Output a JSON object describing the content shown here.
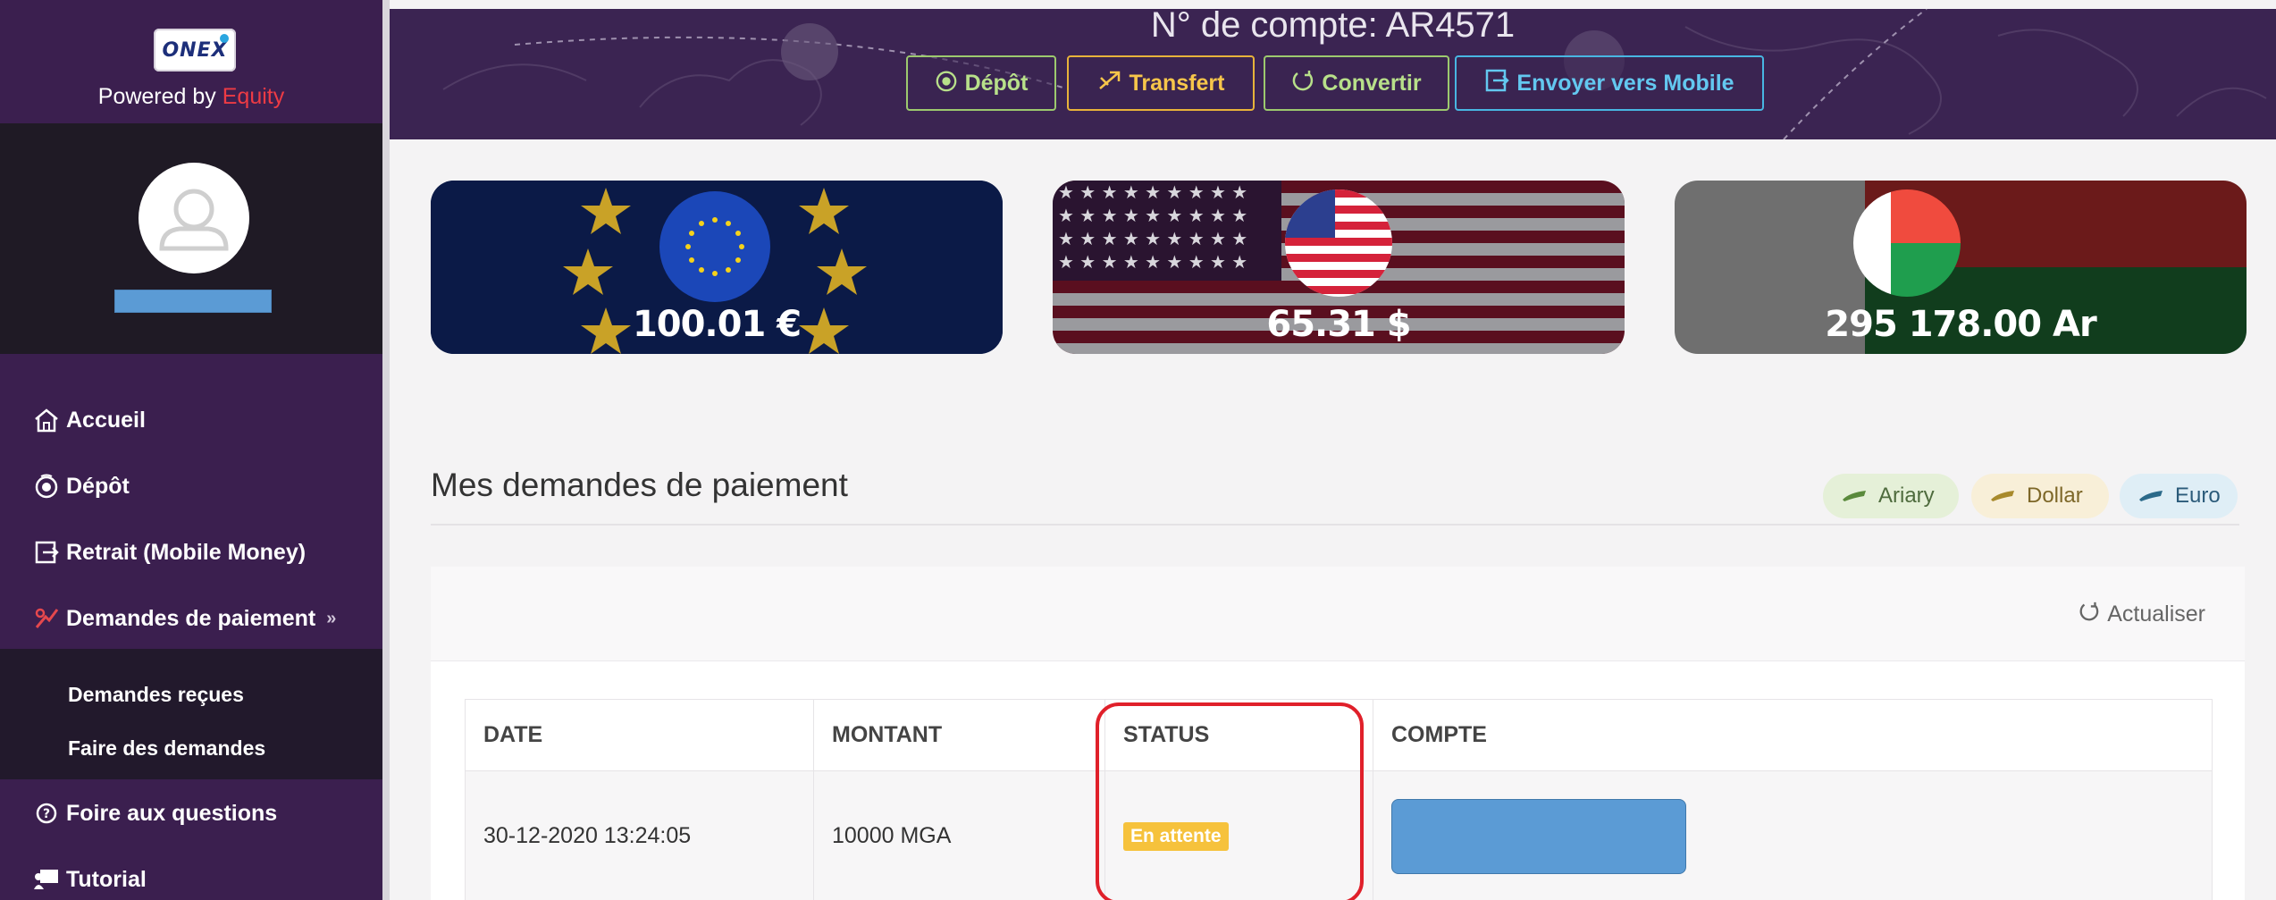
{
  "brand": {
    "logo_text": "ONEX",
    "powered_prefix": "Powered by",
    "powered_brand": "Equity"
  },
  "profile": {
    "avatar_icon": "user-avatar-icon"
  },
  "sidebar": {
    "items": [
      {
        "label": "Accueil",
        "icon": "home-icon"
      },
      {
        "label": "Dépôt",
        "icon": "deposit-icon"
      },
      {
        "label": "Retrait (Mobile Money)",
        "icon": "withdraw-icon"
      },
      {
        "label": "Demandes de paiement",
        "icon": "payment-request-icon",
        "chevron": "»"
      },
      {
        "label": "Foire aux questions",
        "icon": "question-icon"
      },
      {
        "label": "Tutorial",
        "icon": "tutorial-icon"
      }
    ],
    "submenu": [
      {
        "label": "Demandes reçues"
      },
      {
        "label": "Faire des demandes"
      }
    ]
  },
  "header": {
    "account_label": "N° de compte: AR4571",
    "buttons": [
      {
        "label": "Dépôt",
        "icon": "deposit-icon"
      },
      {
        "label": "Transfert",
        "icon": "transfer-icon"
      },
      {
        "label": "Convertir",
        "icon": "convert-icon"
      },
      {
        "label": "Envoyer vers Mobile",
        "icon": "send-mobile-icon"
      }
    ]
  },
  "balances": [
    {
      "currency": "EUR",
      "amount": "100.01 €"
    },
    {
      "currency": "USD",
      "amount": "65.31 $"
    },
    {
      "currency": "MGA",
      "amount": "295 178.00 Ar"
    }
  ],
  "main": {
    "title": "Mes demandes de paiement",
    "filters": [
      {
        "label": "Ariary"
      },
      {
        "label": "Dollar"
      },
      {
        "label": "Euro"
      }
    ],
    "refresh_label": "Actualiser",
    "table": {
      "columns": [
        "DATE",
        "MONTANT",
        "STATUS",
        "COMPTE"
      ],
      "rows": [
        {
          "date": "30-12-2020 13:24:05",
          "montant": "10000 MGA",
          "status": "En attente"
        }
      ]
    }
  },
  "colors": {
    "sidebar_bg": "#3b1f4f",
    "header_bg": "#3b2452",
    "accent_red": "#e0202a",
    "status_pending": "#f6c23c",
    "mask_blue": "#5b9bd5"
  }
}
